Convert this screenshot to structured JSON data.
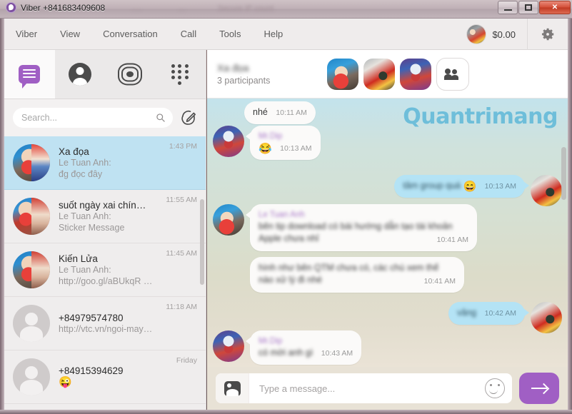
{
  "window": {
    "title": "Viber +841683409608",
    "ghost_titles": [
      "....",
      "...",
      "Secure IP count"
    ],
    "controls": {
      "minimize": "–",
      "maximize": "□",
      "close": "✕"
    },
    "logo_icon": "viber-logo-icon"
  },
  "menubar": {
    "items": [
      {
        "label": "Viber"
      },
      {
        "label": "View"
      },
      {
        "label": "Conversation"
      },
      {
        "label": "Call"
      },
      {
        "label": "Tools"
      },
      {
        "label": "Help"
      }
    ],
    "balance": "$0.00",
    "gear_icon": "gear-icon",
    "avatar_icon": "account-avatar"
  },
  "sidebar": {
    "tabs": [
      {
        "name": "chats",
        "icon": "chat-bubble-icon",
        "active": true
      },
      {
        "name": "contacts",
        "icon": "person-icon",
        "active": false
      },
      {
        "name": "public-accounts",
        "icon": "rings-icon",
        "active": false
      },
      {
        "name": "keypad",
        "icon": "keypad-icon",
        "active": false
      }
    ],
    "search": {
      "placeholder": "Search...",
      "value": "",
      "icon": "search-icon"
    },
    "compose_icon": "compose-icon",
    "chats": [
      {
        "title": "Xa đọa",
        "sender": "Le Tuan Anh:",
        "preview": "đg đọc đây",
        "time": "1:43 PM",
        "selected": true,
        "avatar": "group-kid-avatar",
        "emoji": ""
      },
      {
        "title": "suốt ngày xai chín…",
        "sender": "Le Tuan Anh:",
        "preview": "Sticker Message",
        "time": "11:55 AM",
        "selected": false,
        "avatar": "group-kid-avatar-2",
        "emoji": ""
      },
      {
        "title": "Kiến Lửa",
        "sender": "Le Tuan Anh:",
        "preview": "http://goo.gl/aBUkqR …",
        "time": "11:45 AM",
        "selected": false,
        "avatar": "group-kid-avatar-3",
        "emoji": ""
      },
      {
        "title": "+84979574780",
        "sender": "",
        "preview": "http://vtc.vn/ngoi-may…",
        "time": "11:18 AM",
        "selected": false,
        "avatar": "generic-avatar",
        "emoji": ""
      },
      {
        "title": "+84915394629",
        "sender": "",
        "preview": "",
        "time": "Friday",
        "selected": false,
        "avatar": "generic-avatar",
        "emoji": "😜"
      }
    ]
  },
  "chat": {
    "header": {
      "title": "Xa đọa",
      "participants": "3 participants",
      "participant_avatars": [
        "kid-avatar",
        "red-photo-avatar",
        "indian-mask-avatar"
      ],
      "group_button_icon": "group-people-icon"
    },
    "watermark": "Quantrimang",
    "messages": [
      {
        "id": "m1",
        "direction": "in",
        "sender": "",
        "text": "nhé",
        "blurred": false,
        "time": "10:11 AM",
        "avatar": "",
        "emoji": ""
      },
      {
        "id": "m2",
        "direction": "in",
        "sender": "Mr.Dip",
        "text": "",
        "blurred": true,
        "time": "10:13 AM",
        "avatar": "indian-mask-avatar",
        "emoji": "😂"
      },
      {
        "id": "m3",
        "direction": "out",
        "sender": "",
        "text": "tâm group quá",
        "blurred": true,
        "time": "10:13 AM",
        "avatar": "red-photo-avatar",
        "emoji": "😄"
      },
      {
        "id": "m4",
        "direction": "in",
        "sender": "Le Tuan Anh",
        "text": "bên tip download có bài hướng dẫn tạo tài khoản Apple chưa nhỉ",
        "blurred": true,
        "time": "10:41 AM",
        "avatar": "kid-avatar",
        "emoji": ""
      },
      {
        "id": "m5",
        "direction": "in",
        "sender": "",
        "text": "hình như bên QTM chưa có, các chú xem thế nào xử lý đi nhé",
        "blurred": true,
        "time": "10:41 AM",
        "avatar": "",
        "emoji": ""
      },
      {
        "id": "m6",
        "direction": "out",
        "sender": "",
        "text": "vâng",
        "blurred": true,
        "time": "10:42 AM",
        "avatar": "red-photo-avatar",
        "emoji": ""
      },
      {
        "id": "m7",
        "direction": "in",
        "sender": "Mr.Dip",
        "text": "có mời anh gì",
        "blurred": true,
        "time": "10:43 AM",
        "avatar": "indian-mask-avatar",
        "emoji": ""
      }
    ],
    "composer": {
      "placeholder": "Type a message...",
      "value": "",
      "attach_icon": "photo-attach-icon",
      "emoji_icon": "smiley-icon",
      "send_icon": "send-arrow-icon",
      "send_color": "#a05fc4"
    }
  }
}
